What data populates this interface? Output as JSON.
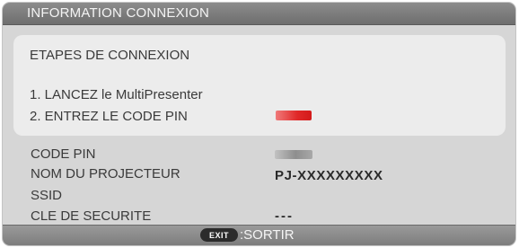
{
  "window": {
    "title": "INFORMATION CONNEXION"
  },
  "steps_panel": {
    "heading": "ETAPES DE CONNEXION",
    "step1": "1. LANCEZ le MultiPresenter",
    "step2": "2. ENTREZ LE CODE PIN"
  },
  "info": {
    "pin_label": "CODE PIN",
    "projector_name_label": "NOM DU PROJECTEUR",
    "projector_name_value": "PJ-XXXXXXXXX",
    "ssid_label": "SSID",
    "security_key_label": "CLE DE SECURITE",
    "security_key_value": "---"
  },
  "footer": {
    "exit_key": "EXIT",
    "exit_label": ":SORTIR"
  },
  "colors": {
    "pin_highlight": "#e02828",
    "titlebar": "#7d7d7d"
  }
}
